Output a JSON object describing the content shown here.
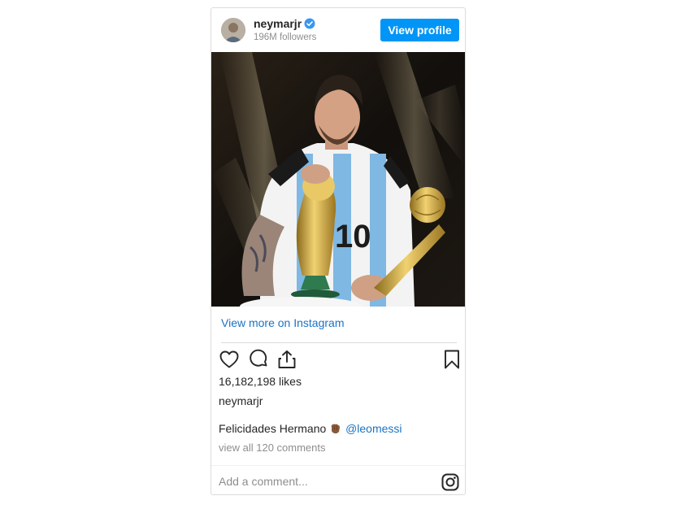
{
  "post": {
    "username": "neymarjr",
    "followers": "196M followers",
    "view_profile_label": "View profile",
    "view_more_label": "View more on Instagram",
    "likes": "16,182,198 likes",
    "owner": "neymarjr",
    "caption_text": "Felicidades Hermano",
    "caption_emoji": "clapping-hands-emoji",
    "caption_mention": "@leomessi",
    "comments_link": "view all 120 comments",
    "comment_placeholder": "Add a comment..."
  },
  "icons": {
    "verified": "verified-badge-icon",
    "like": "heart-icon",
    "comment": "comment-icon",
    "share": "share-icon",
    "save": "bookmark-icon",
    "brand": "instagram-icon"
  },
  "colors": {
    "accent": "#0095f6",
    "link": "#1a73c4",
    "muted": "#8e8e8e",
    "text": "#262626",
    "border": "#dbdbdb"
  }
}
